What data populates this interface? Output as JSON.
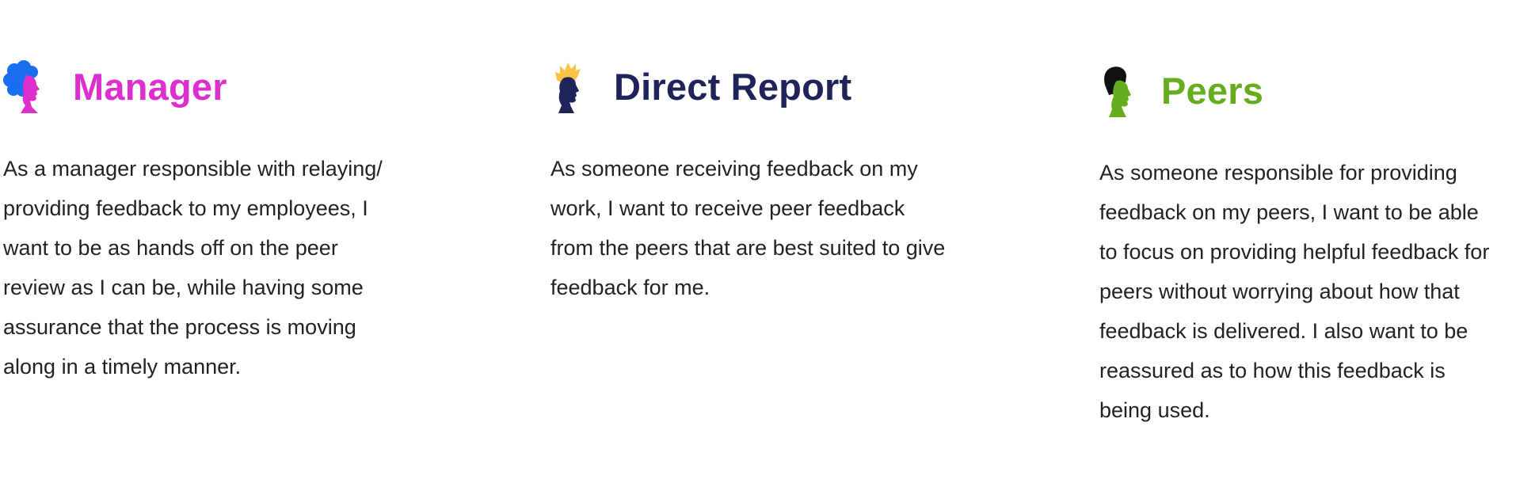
{
  "personas": [
    {
      "title": "Manager",
      "icon": "woman-profile-icon",
      "color": "#dc2fcd",
      "body": "As a manager responsible with relaying/\nproviding feedback to my employees, I\nwant to be as hands off on the peer\nreview as I can be, while having some\nassurance that the process is moving\nalong in a timely manner."
    },
    {
      "title": "Direct Report",
      "icon": "man-profile-icon",
      "color": "#1e2359",
      "body": "As someone receiving feedback on my\nwork, I want to receive peer feedback\nfrom the peers that are best suited to give\nfeedback for me."
    },
    {
      "title": "Peers",
      "icon": "person-profile-icon",
      "color": "#66ad1e",
      "body": "As someone responsible for providing\nfeedback on my peers, I want to be able\nto focus on providing helpful feedback for\npeers without worrying about how that\nfeedback is delivered. I also want to be\nreassured as to how this feedback is\nbeing used."
    }
  ]
}
